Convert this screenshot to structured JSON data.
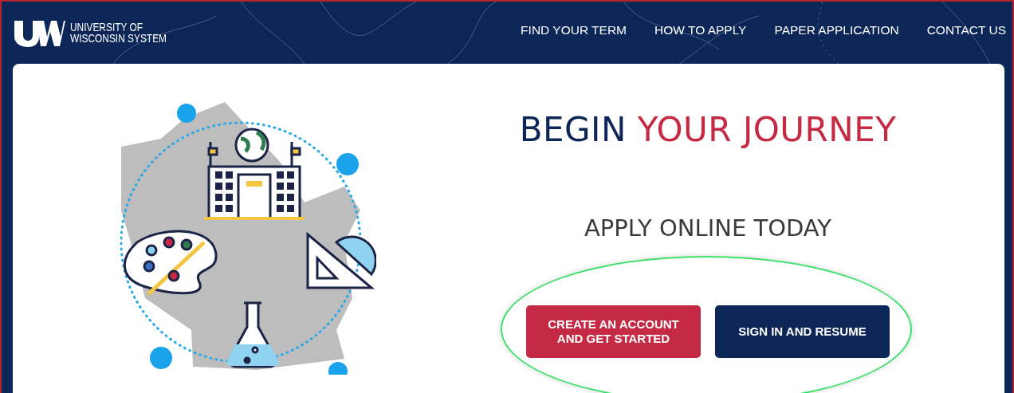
{
  "header": {
    "logo_text": [
      "UNIVERSITY OF",
      "WISCONSIN SYSTEM"
    ],
    "nav": [
      {
        "label": "FIND YOUR TERM"
      },
      {
        "label": "HOW TO APPLY"
      },
      {
        "label": "PAPER APPLICATION"
      },
      {
        "label": "CONTACT US"
      }
    ]
  },
  "hero": {
    "title_lead": "BEGIN",
    "title_accent": "YOUR JOURNEY",
    "subtitle": "APPLY ONLINE TODAY",
    "buttons": [
      {
        "label": "CREATE AN ACCOUNT AND GET STARTED",
        "kind": "primary"
      },
      {
        "label": "SIGN IN AND RESUME",
        "kind": "secondary"
      }
    ],
    "buttons_highlighted": true
  }
}
